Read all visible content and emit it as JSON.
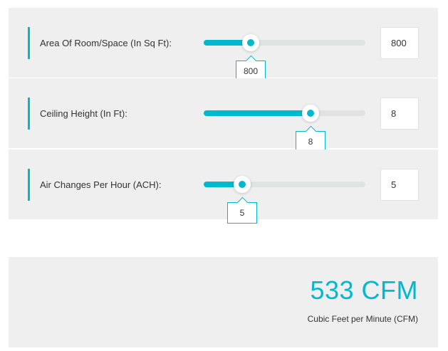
{
  "accent_color": "#00b9cf",
  "sliders": [
    {
      "label": "Area Of Room/Space (In Sq Ft):",
      "value": "800",
      "tooltip": "800",
      "fraction": 0.29
    },
    {
      "label": "Ceiling Height (In Ft):",
      "value": "8",
      "tooltip": "8",
      "fraction": 0.66
    },
    {
      "label": "Air Changes Per Hour (ACH):",
      "value": "5",
      "tooltip": "5",
      "fraction": 0.24
    }
  ],
  "result": {
    "value": "533 CFM",
    "caption": "Cubic Feet per Minute (CFM)"
  }
}
